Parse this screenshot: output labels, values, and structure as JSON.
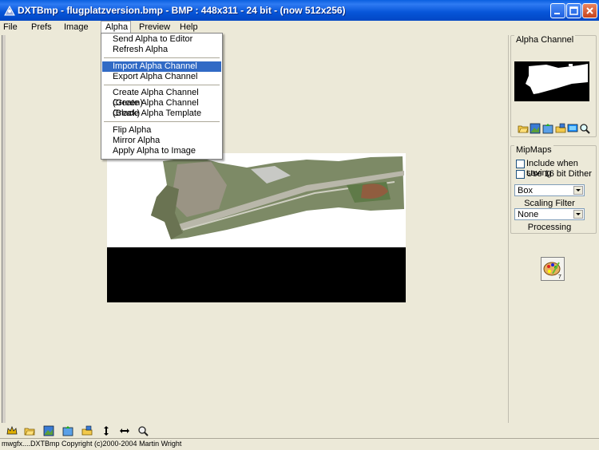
{
  "window": {
    "title": "DXTBmp - flugplatzversion.bmp - BMP : 448x311 - 24 bit - (now 512x256)"
  },
  "menubar": [
    "File",
    "Prefs",
    "Image",
    "Alpha",
    "Preview",
    "Help"
  ],
  "alpha_menu": {
    "group1": [
      "Send Alpha to Editor",
      "Refresh Alpha"
    ],
    "group2": [
      "Import Alpha Channel",
      "Export Alpha Channel"
    ],
    "group3": [
      "Create Alpha Channel (Green)",
      "Create Alpha Channel (Black)",
      "Create Alpha Template"
    ],
    "group4": [
      "Flip Alpha",
      "Mirror Alpha",
      "Apply Alpha to Image"
    ],
    "highlighted": "Import Alpha Channel"
  },
  "side_panel": {
    "alpha_channel_label": "Alpha Channel",
    "mipmaps_label": "MipMaps",
    "include_when_saving": "Include when saving",
    "use_16bit_dither": "Use 16 bit Dither",
    "scaling_filter_value": "Box",
    "scaling_filter_label": "Scaling Filter",
    "processing_value": "None",
    "processing_label": "Processing",
    "paint_badge": "7"
  },
  "status": {
    "text": "mwgfx....DXTBmp Copyright (c)2000-2004 Martin Wright"
  },
  "colors": {
    "titlebar": "#0654d8",
    "menu_highlight": "#316ac5",
    "window_bg": "#ece9d8"
  }
}
